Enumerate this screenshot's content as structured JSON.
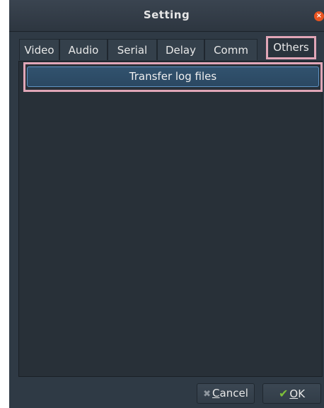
{
  "window": {
    "title": "Setting",
    "close_glyph": "×"
  },
  "tabs": [
    {
      "label": "Video",
      "active": false
    },
    {
      "label": "Audio",
      "active": false
    },
    {
      "label": "Serial",
      "active": false
    },
    {
      "label": "Delay",
      "active": false
    },
    {
      "label": "Comm",
      "active": false
    },
    {
      "label": "Others",
      "active": true
    }
  ],
  "others_panel": {
    "transfer_button_label": "Transfer log files"
  },
  "footer": {
    "cancel_mnemonic": "C",
    "cancel_rest": "ancel",
    "ok_mnemonic": "O",
    "ok_rest": "K",
    "cancel_icon": "x-icon",
    "ok_icon": "check-icon"
  },
  "colors": {
    "window_bg": "#2f3a45",
    "highlight_outline": "#e0a6b7",
    "button_focus_border": "#5f93c4",
    "close_button": "#e95420",
    "ok_check": "#7ec03a"
  }
}
